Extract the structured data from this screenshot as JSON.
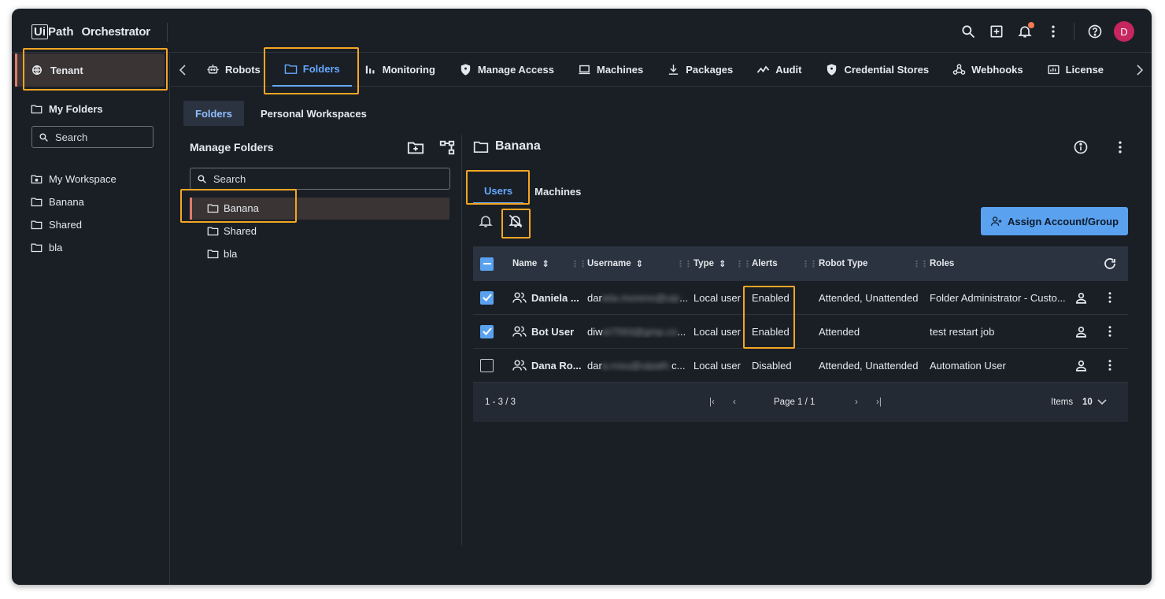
{
  "app": {
    "logo_ui": "Ui",
    "logo_path": "Path",
    "title": "Orchestrator",
    "avatar_initial": "D",
    "brand_color": "#5aa2ef",
    "highlight_color": "#f5a623"
  },
  "leftnav": {
    "tenant": "Tenant",
    "my_folders": "My Folders",
    "search_placeholder": "Search",
    "items": [
      {
        "label": "My Workspace",
        "icon": "workspace-icon"
      },
      {
        "label": "Banana",
        "icon": "folder-icon"
      },
      {
        "label": "Shared",
        "icon": "folder-icon"
      },
      {
        "label": "bla",
        "icon": "folder-icon"
      }
    ]
  },
  "tabs": [
    {
      "label": "Robots",
      "icon": "robot-icon"
    },
    {
      "label": "Folders",
      "icon": "folder-icon",
      "active": true
    },
    {
      "label": "Monitoring",
      "icon": "bar-chart-icon"
    },
    {
      "label": "Manage Access",
      "icon": "shield-icon"
    },
    {
      "label": "Machines",
      "icon": "laptop-icon"
    },
    {
      "label": "Packages",
      "icon": "download-icon"
    },
    {
      "label": "Audit",
      "icon": "trend-icon"
    },
    {
      "label": "Credential Stores",
      "icon": "shield-icon"
    },
    {
      "label": "Webhooks",
      "icon": "webhook-icon"
    },
    {
      "label": "License",
      "icon": "license-icon"
    }
  ],
  "subtabs": {
    "folders": "Folders",
    "personal_workspaces": "Personal Workspaces"
  },
  "manage_folders": {
    "title": "Manage Folders",
    "search_placeholder": "Search",
    "tree": [
      "Banana",
      "Shared",
      "bla"
    ]
  },
  "detail": {
    "title": "Banana",
    "tab_users": "Users",
    "tab_machines": "Machines",
    "assign_button": "Assign Account/Group",
    "columns": {
      "name": "Name",
      "username": "Username",
      "type": "Type",
      "alerts": "Alerts",
      "robot_type": "Robot Type",
      "roles": "Roles"
    },
    "rows": [
      {
        "name": "Daniela ...",
        "username_prefix": "dar",
        "username_hidden": "iela.moreno@uip",
        "username_suffix": "...",
        "type": "Local user",
        "alerts": "Enabled",
        "robot_type": "Attended, Unattended",
        "roles": "Folder Administrator - Custo...",
        "checked": true
      },
      {
        "name": "Bot User",
        "username_prefix": "diw",
        "username_hidden": "ei7593@gmp.co",
        "username_suffix": "...",
        "type": "Local user",
        "alerts": "Enabled",
        "robot_type": "Attended",
        "roles": "test restart job",
        "checked": true
      },
      {
        "name": "Dana Ro...",
        "username_prefix": "dar",
        "username_hidden": "a.rosu@uipath.",
        "username_suffix": "c...",
        "type": "Local user",
        "alerts": "Disabled",
        "robot_type": "Attended, Unattended",
        "roles": "Automation User",
        "checked": false
      }
    ],
    "footer": {
      "range": "1 - 3 / 3",
      "page": "Page 1 / 1",
      "items_label": "Items",
      "items_value": "10"
    }
  }
}
